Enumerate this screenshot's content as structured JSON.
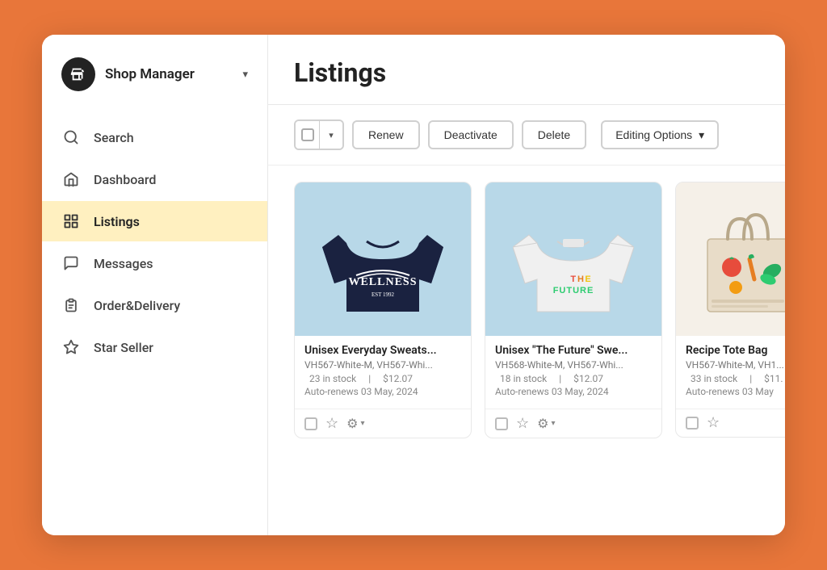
{
  "sidebar": {
    "shop_manager_label": "Shop Manager",
    "items": [
      {
        "id": "search",
        "label": "Search",
        "icon": "search"
      },
      {
        "id": "dashboard",
        "label": "Dashboard",
        "icon": "home"
      },
      {
        "id": "listings",
        "label": "Listings",
        "icon": "grid",
        "active": true
      },
      {
        "id": "messages",
        "label": "Messages",
        "icon": "message"
      },
      {
        "id": "order-delivery",
        "label": "Order&Delivery",
        "icon": "clipboard"
      },
      {
        "id": "star-seller",
        "label": "Star Seller",
        "icon": "star"
      }
    ]
  },
  "main": {
    "page_title": "Listings",
    "toolbar": {
      "renew_label": "Renew",
      "deactivate_label": "Deactivate",
      "delete_label": "Delete",
      "editing_options_label": "Editing Options"
    },
    "products": [
      {
        "id": 1,
        "title": "Unisex Everyday Sweats...",
        "variants": "VH567-White-M, VH567-Whi...",
        "stock": "23 in stock",
        "price": "$12.07",
        "renews": "Auto-renews 03 May, 2024",
        "color": "dark-sweatshirt"
      },
      {
        "id": 2,
        "title": "Unisex \"The Future\" Swe...",
        "variants": "VH568-White-M, VH567-Whi...",
        "stock": "18 in stock",
        "price": "$12.07",
        "renews": "Auto-renews 03 May, 2024",
        "color": "white-sweatshirt"
      },
      {
        "id": 3,
        "title": "Recipe Tote Bag",
        "variants": "VH567-White-M, VH1...",
        "stock": "33 in stock",
        "price": "$11.",
        "renews": "Auto-renews 03 May",
        "color": "tote-bag"
      }
    ]
  },
  "colors": {
    "orange_bg": "#E8763A",
    "active_nav": "#FFF0C0",
    "product_bg_blue": "#B8D8E8",
    "product_bg_cream": "#f5f0e8"
  }
}
